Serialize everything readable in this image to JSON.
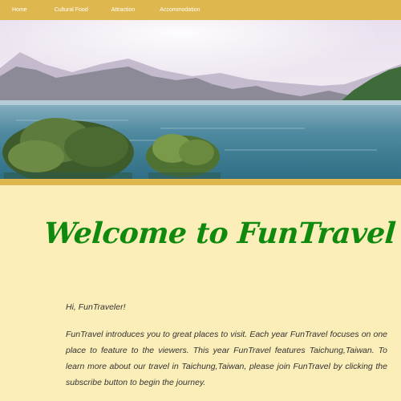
{
  "nav": {
    "items": [
      {
        "label": "Home"
      },
      {
        "label": "Cultural Food"
      },
      {
        "label": "Attraction"
      },
      {
        "label": "Accommodation"
      }
    ]
  },
  "colors": {
    "nav_bg": "#dfb74f",
    "page_bg": "#fbeeb8",
    "heading": "#0f8a0f",
    "body_text": "#333333"
  },
  "main": {
    "title": "Welcome to FunTravel",
    "greeting": "Hi, FunTraveler!",
    "intro": "FunTravel introduces you to great places to visit. Each year FunTravel focuses on one place to feature to the viewers. This year FunTravel features Taichung,Taiwan. To learn more about our travel in Taichung,Taiwan, please join FunTravel by clicking the subscribe button to begin the journey."
  }
}
